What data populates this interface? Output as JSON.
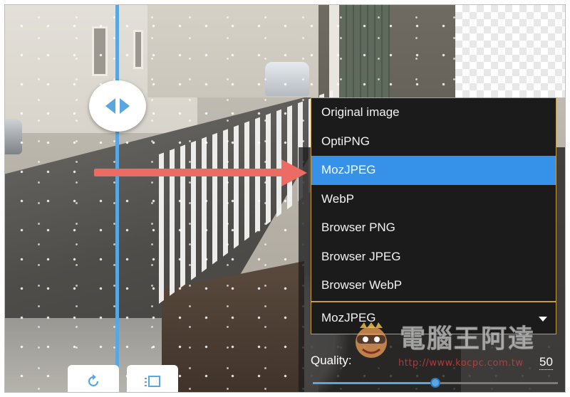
{
  "compare": {
    "divider_icons": [
      "chevron-left-icon",
      "chevron-right-icon"
    ]
  },
  "annotation": {
    "arrow_color": "#ec6b63"
  },
  "menu": {
    "items": [
      {
        "label": "Original image",
        "selected": false
      },
      {
        "label": "OptiPNG",
        "selected": false
      },
      {
        "label": "MozJPEG",
        "selected": true
      },
      {
        "label": "WebP",
        "selected": false
      },
      {
        "label": "Browser PNG",
        "selected": false
      },
      {
        "label": "Browser JPEG",
        "selected": false
      },
      {
        "label": "Browser WebP",
        "selected": false
      }
    ],
    "highlight_color": "#3592e8",
    "border_color": "#c79a45"
  },
  "select": {
    "value": "MozJPEG",
    "caret_icon": "caret-down-icon"
  },
  "quality": {
    "label": "Quality:",
    "value": "50",
    "slider_fraction": 0.5,
    "accent": "#5aa6e0"
  },
  "toolbar": {
    "buttons": [
      {
        "icon": "rotate-icon"
      },
      {
        "icon": "background-toggle-icon"
      }
    ]
  },
  "watermark": {
    "title": "電腦王阿達",
    "url": "http://www.kocpc.com.tw"
  }
}
